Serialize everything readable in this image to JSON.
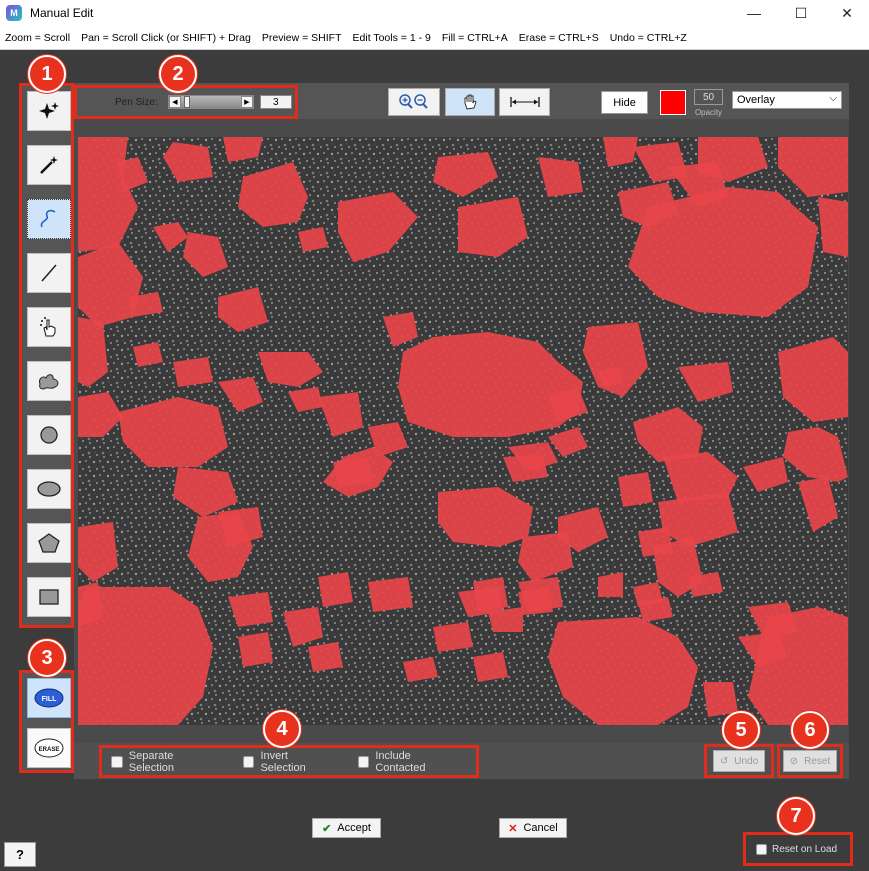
{
  "window": {
    "title": "Manual Edit",
    "icon_letter": "M",
    "minimize": "—",
    "maximize": "☐",
    "close": "✕"
  },
  "hotkeys": [
    "Zoom = Scroll",
    "Pan = Scroll Click (or SHIFT) + Drag",
    "Preview = SHIFT",
    "Edit Tools = 1 - 9",
    "Fill = CTRL+A",
    "Erase = CTRL+S",
    "Undo = CTRL+Z"
  ],
  "tools": [
    {
      "name": "auto-select-icon"
    },
    {
      "name": "magic-wand-icon"
    },
    {
      "name": "freehand-pen-icon",
      "active": true
    },
    {
      "name": "line-icon"
    },
    {
      "name": "hand-pointer-icon"
    },
    {
      "name": "blob-icon"
    },
    {
      "name": "circle-icon"
    },
    {
      "name": "ellipse-icon"
    },
    {
      "name": "polygon-icon"
    },
    {
      "name": "rectangle-icon"
    }
  ],
  "fill_label": "FILL",
  "erase_label": "ERASE",
  "pen": {
    "label": "Pen Size:",
    "value": "3",
    "slider_fraction": 0.05
  },
  "display": {
    "hide_label": "Hide",
    "color": "#ff0000",
    "opacity_value": "50",
    "opacity_label": "Opacity",
    "mode": "Overlay"
  },
  "options": {
    "separate": "Separate Selection",
    "invert": "Invert Selection",
    "include": "Include Contacted"
  },
  "undo_label": "Undo",
  "reset_label": "Reset",
  "accept_label": "Accept",
  "cancel_label": "Cancel",
  "reset_on_load_label": "Reset on Load",
  "help_label": "?",
  "callouts": [
    "1",
    "2",
    "3",
    "4",
    "5",
    "6",
    "7"
  ]
}
